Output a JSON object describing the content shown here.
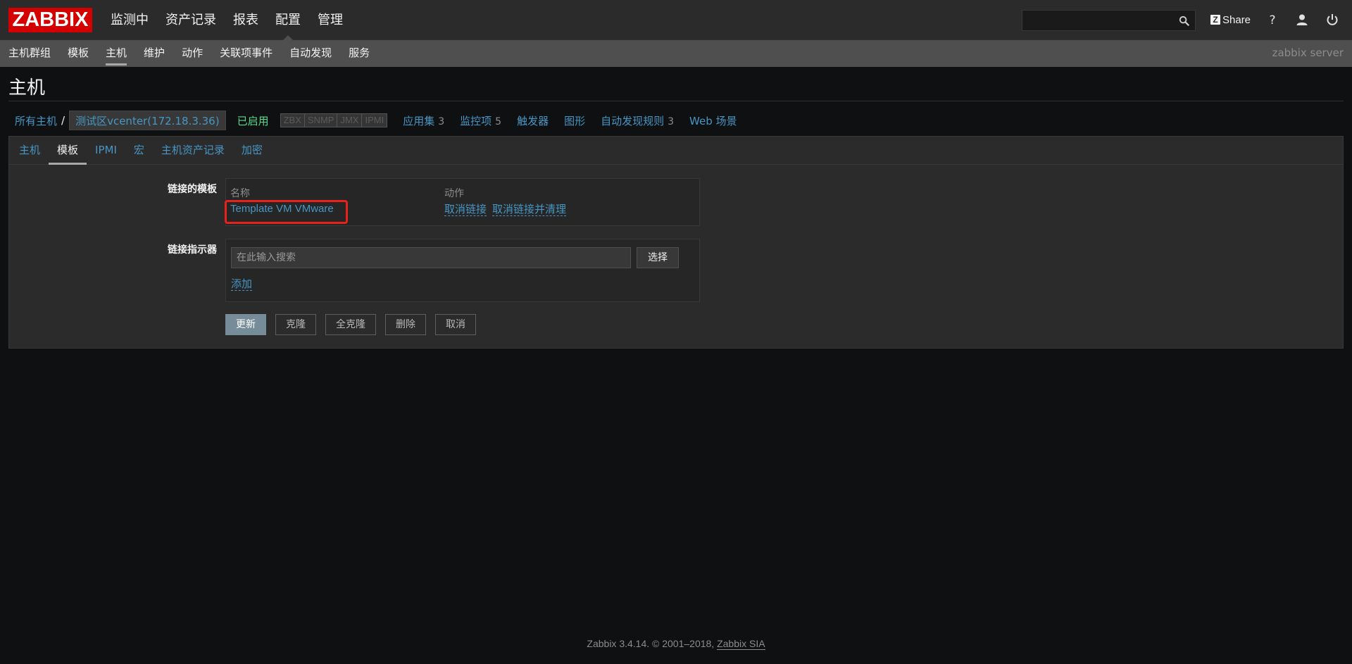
{
  "header": {
    "logo": "ZABBIX",
    "main_menu": [
      "监测中",
      "资产记录",
      "报表",
      "配置",
      "管理"
    ],
    "active_main": "配置",
    "search": {
      "value": "",
      "placeholder": ""
    },
    "share_label": "Share",
    "share_logo": "Z",
    "icons": [
      "search-icon",
      "share-icon",
      "help-icon",
      "user-profile-icon",
      "logout-icon"
    ]
  },
  "sub_nav": {
    "items": [
      "主机群组",
      "模板",
      "主机",
      "维护",
      "动作",
      "关联项事件",
      "自动发现",
      "服务"
    ],
    "active": "主机",
    "server_name": "zabbix server"
  },
  "page_title": "主机",
  "host_nav": {
    "all_hosts": "所有主机",
    "separator": "/",
    "current_host": "测试区vcenter(172.18.3.36)",
    "status": "已启用",
    "availability": [
      "ZBX",
      "SNMP",
      "JMX",
      "IPMI"
    ],
    "items": [
      {
        "label": "应用集",
        "count": "3"
      },
      {
        "label": "监控项",
        "count": "5"
      },
      {
        "label": "触发器",
        "count": ""
      },
      {
        "label": "图形",
        "count": ""
      },
      {
        "label": "自动发现规则",
        "count": "3"
      },
      {
        "label": "Web 场景",
        "count": ""
      }
    ]
  },
  "tabs": {
    "items": [
      "主机",
      "模板",
      "IPMI",
      "宏",
      "主机资产记录",
      "加密"
    ],
    "active": "模板"
  },
  "form": {
    "linked_templates_label": "链接的模板",
    "col_name": "名称",
    "col_action": "动作",
    "template_name": "Template VM VMware",
    "unlink": "取消链接",
    "unlink_clear": "取消链接并清理",
    "link_indicator_label": "链接指示器",
    "search_placeholder": "在此输入搜索",
    "search_value": "",
    "select_label": "选择",
    "add_label": "添加",
    "buttons": {
      "update": "更新",
      "clone": "克隆",
      "full_clone": "全克隆",
      "delete": "删除",
      "cancel": "取消"
    }
  },
  "footer": {
    "text": "Zabbix 3.4.14. © 2001–2018,",
    "link": "Zabbix SIA"
  },
  "colors": {
    "accent_link": "#4796c4",
    "logo_red": "#d40000",
    "enabled_green": "#59db8f",
    "highlight_red": "#e8221b",
    "primary_button": "#768d99"
  }
}
